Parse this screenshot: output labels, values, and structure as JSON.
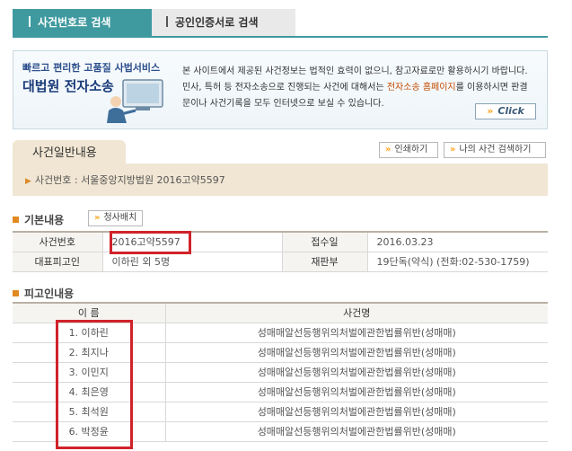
{
  "tabs": [
    {
      "label": "사건번호로 검색",
      "active": true
    },
    {
      "label": "공인인증서로 검색",
      "active": false
    }
  ],
  "banner": {
    "subtitle": "빠르고 편리한 고품질 사법서비스",
    "title": "대법원 전자소송",
    "text_line1": "본 사이트에서 제공된 사건정보는 법적인 효력이 없으니, 참고자료로만 활용하시기 바랍니다.",
    "text_line2_pre": "민사, 특허 등 전자소송으로 진행되는 사건에 대해서는 ",
    "text_line2_link": "전자소송 홈페이지",
    "text_line2_post": "를 이용하시면 판결",
    "text_line3": "문이나 사건기록을 모두 인터넷으로 보실 수 있습니다.",
    "click_label": "Click"
  },
  "general": {
    "tab_label": "사건일반내용",
    "case_line": "사건번호 : 서울중앙지방법원 2016고약5597",
    "print_label": "인쇄하기",
    "mycase_label": "나의 사건 검색하기"
  },
  "basic": {
    "title": "기본내용",
    "court_button": "청사배치",
    "rows": [
      {
        "l1": "사건번호",
        "v1": "2016고약5597",
        "l2": "접수일",
        "v2": "2016.03.23"
      },
      {
        "l1": "대표피고인",
        "v1": "이하린 외 5명",
        "l2": "재판부",
        "v2": "19단독(약식) (전화:02-530-1759)"
      }
    ]
  },
  "defendants": {
    "title": "피고인내용",
    "col_name": "이 름",
    "col_case": "사건명",
    "rows": [
      {
        "name": "1. 이하린",
        "case": "성매매알선등행위의처벌에관한법률위반(성매매)"
      },
      {
        "name": "2. 최지나",
        "case": "성매매알선등행위의처벌에관한법률위반(성매매)"
      },
      {
        "name": "3. 이민지",
        "case": "성매매알선등행위의처벌에관한법률위반(성매매)"
      },
      {
        "name": "4. 최은영",
        "case": "성매매알선등행위의처벌에관한법률위반(성매매)"
      },
      {
        "name": "5. 최석원",
        "case": "성매매알선등행위의처벌에관한법률위반(성매매)"
      },
      {
        "name": "6. 박정윤",
        "case": "성매매알선등행위의처벌에관한법률위반(성매매)"
      }
    ]
  },
  "colors": {
    "accent": "#3f9aa0",
    "highlight": "#d0222a",
    "beige": "#f1e6d3",
    "orange": "#e28a22"
  }
}
